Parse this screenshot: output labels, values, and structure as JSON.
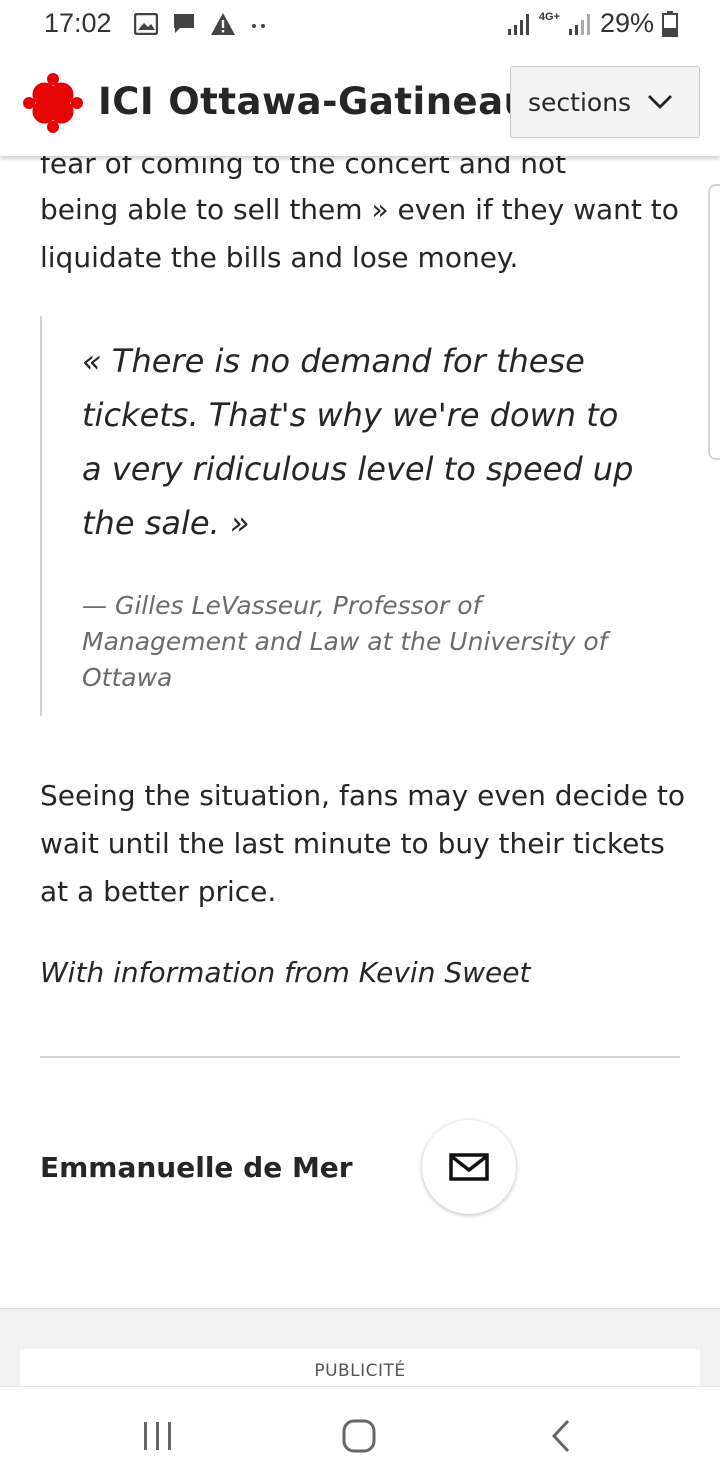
{
  "status_bar": {
    "time": "17:02",
    "network": "4G+",
    "battery": "29%",
    "left_icons": [
      "image-icon",
      "message-icon",
      "warning-icon",
      "more-dots-icon"
    ]
  },
  "header": {
    "brand_prefix": "ICI",
    "region": "Ottawa-Gatineau",
    "sections_label": "sections",
    "logo_color": "#e60505"
  },
  "article": {
    "para_top": "fear of coming to the concert and not",
    "para_continued": "being able to sell them » even if they want to liquidate the bills and lose money.",
    "quote": "« There is no demand for these tickets. That's why we're down to a very ridiculous level to speed up the sale. »",
    "quote_citation": "— Gilles LeVasseur, Professor of Management and Law at the University of Ottawa",
    "para_after": "Seeing the situation, fans may even decide to wait until the last minute to buy their tickets at a better price.",
    "credit": "With information from Kevin Sweet",
    "author": "Emmanuelle de Mer"
  },
  "ad": {
    "label": "PUBLICITÉ"
  },
  "nav": [
    "recent-apps-icon",
    "home-icon",
    "back-icon"
  ]
}
